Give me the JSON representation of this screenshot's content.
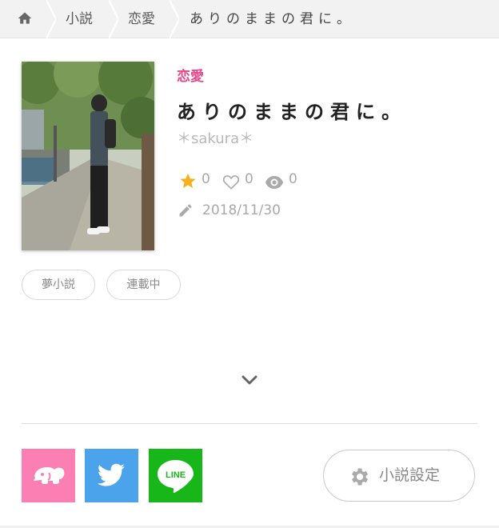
{
  "breadcrumb": {
    "home_icon": "home-icon",
    "items": [
      "小説",
      "恋愛",
      "ありのままの君に。"
    ]
  },
  "book": {
    "genre": "恋愛",
    "title": "ありのままの君に。",
    "author": "＊sakura＊",
    "stats": {
      "stars": "0",
      "likes": "0",
      "views": "0"
    },
    "date": "2018/11/30",
    "tags": [
      "夢小説",
      "連載中"
    ]
  },
  "share": {
    "buttons": [
      {
        "name": "elephant-share",
        "color": "#fb7fb2"
      },
      {
        "name": "twitter-share",
        "color": "#4ba3ec"
      },
      {
        "name": "line-share",
        "color": "#17b719",
        "label": "LINE"
      }
    ]
  },
  "settings_button": {
    "label": "小説設定"
  },
  "colors": {
    "accent": "#e8478b",
    "star": "#f6b01d"
  }
}
